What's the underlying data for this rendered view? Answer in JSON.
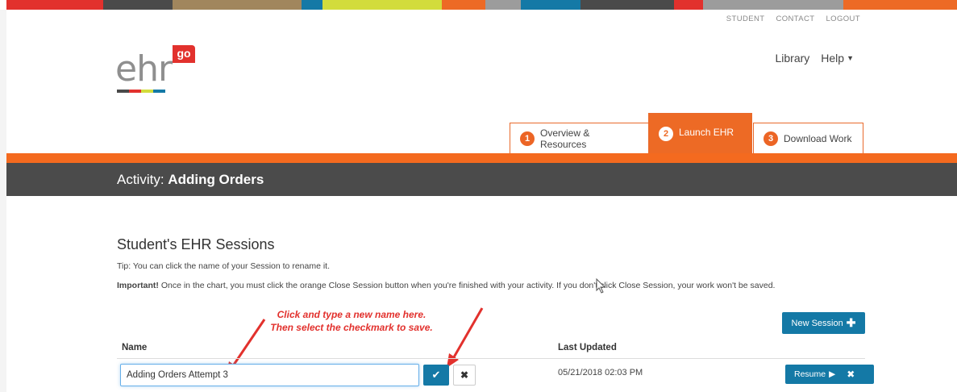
{
  "colorbar": [
    {
      "color": "#ffffff"
    },
    {
      "color": "#e2312d"
    },
    {
      "color": "#4a4a4a"
    },
    {
      "color": "#a1865d"
    },
    {
      "color": "#1479a6"
    },
    {
      "color": "#d2dc3c"
    },
    {
      "color": "#ed6a25"
    },
    {
      "color": "#9c9c9c"
    },
    {
      "color": "#1479a6"
    },
    {
      "color": "#4a4a4a"
    },
    {
      "color": "#e2312d"
    },
    {
      "color": "#9c9c9c"
    },
    {
      "color": "#ed6a25"
    }
  ],
  "topnav": {
    "student": "STUDENT",
    "contact": "CONTACT",
    "logout": "LOGOUT"
  },
  "logo": {
    "text": "ehr",
    "badge": "go"
  },
  "mainmenu": {
    "library": "Library",
    "help": "Help"
  },
  "tabs": [
    {
      "num": "1",
      "label": "Overview & Resources",
      "active": false
    },
    {
      "num": "2",
      "label": "Launch EHR",
      "active": true
    },
    {
      "num": "3",
      "label": "Download Work",
      "active": false
    }
  ],
  "activity": {
    "prefix": "Activity:",
    "name": "Adding Orders"
  },
  "sessions": {
    "title": "Student's EHR Sessions",
    "tip": "Tip: You can click the name of your Session to rename it.",
    "important_label": "Important!",
    "important_text": " Once in the chart, you must click the orange Close Session button when you're finished with your activity. If you don't click Close Session, your work won't be saved.",
    "new_session": "New Session",
    "columns": {
      "name": "Name",
      "last_updated": "Last Updated"
    },
    "row": {
      "name_value": "Adding Orders Attempt 3",
      "last_updated": "05/21/2018 02:03 PM",
      "resume": "Resume"
    }
  },
  "annotation": {
    "line1": "Click and type a new name here.",
    "line2": "Then select the checkmark to save."
  },
  "colors": {
    "brand_orange": "#ed6a25",
    "brand_blue": "#1479a6",
    "annotation_red": "#e2312d",
    "dark_bar": "#4b4b4b"
  }
}
